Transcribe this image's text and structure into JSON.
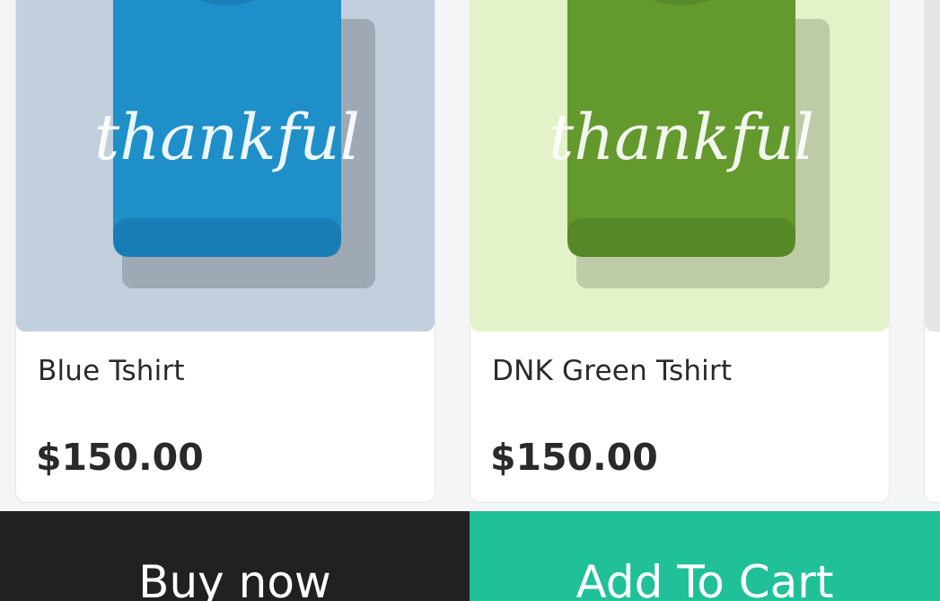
{
  "products": [
    {
      "name": "Blue Tshirt",
      "price": "$150.00",
      "print_text": "thankful",
      "bg_color": "#c2cfdd",
      "shirt_color": "#1e8fc8",
      "shirt_shade": "#156fa6"
    },
    {
      "name": "DNK Green Tshirt",
      "price": "$150.00",
      "print_text": "thankful",
      "bg_color": "#e3f2c8",
      "shirt_color": "#64992e",
      "shirt_shade": "#4b7a1f"
    },
    {
      "name": "",
      "price": "",
      "print_text": "",
      "bg_color": "#e6e6e6",
      "shirt_color": "#d8d8d8",
      "shirt_shade": "#c8c8c8"
    }
  ],
  "actions": {
    "buy_now_label": "Buy now",
    "add_to_cart_label": "Add To Cart",
    "buy_now_color": "#212121",
    "add_to_cart_color": "#20c099"
  }
}
